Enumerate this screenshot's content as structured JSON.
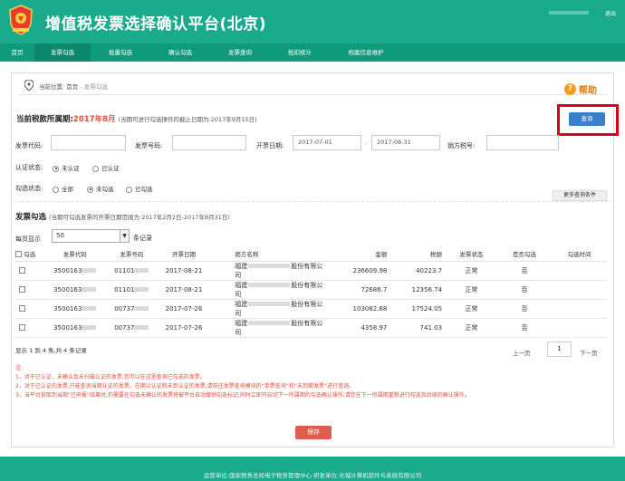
{
  "header": {
    "title": "增值税发票选择确认平台(北京)",
    "logout": "退出",
    "brand_color": "#1aab8c"
  },
  "nav": {
    "items": [
      {
        "label": "首页",
        "width": 38
      },
      {
        "label": "发票勾选",
        "width": 62,
        "active": true
      },
      {
        "label": "批量勾选",
        "width": 66
      },
      {
        "label": "确认勾选",
        "width": 66
      },
      {
        "label": "发票查询",
        "width": 66
      },
      {
        "label": "抵扣统计",
        "width": 66
      },
      {
        "label": "档案信息维护",
        "width": 80
      }
    ]
  },
  "breadcrumb": {
    "label": "当前位置:",
    "home": "首页",
    "sep": " - ",
    "current": "发票勾选"
  },
  "help": {
    "label": "帮助"
  },
  "period": {
    "label": "当前税款所属期:",
    "value": "2017年8月",
    "note": "(当期可进行勾选操作的截止日期为:2017年9月15日)"
  },
  "query_button": "查询",
  "filters": {
    "invoice_code_label": "发票代码:",
    "invoice_number_label": "发票号码:",
    "date_label": "开票日期:",
    "date_from": "2017-07-01",
    "date_sep": "-",
    "date_to": "2017-08-31",
    "seller_tax_label": "销方税号:",
    "auth_label": "认证状态:",
    "auth_options": [
      "未认证",
      "已认证"
    ],
    "check_label": "勾选状态:",
    "check_options": [
      "全部",
      "未勾选",
      "已勾选"
    ],
    "more_button": "更多查询条件"
  },
  "invoice_section": {
    "title": "发票勾选",
    "note": "(当期可勾选发票的开票日期范围为:2017年2月2日-2017年8月31日)",
    "page_size_label": "每页显示",
    "page_size": "50",
    "records_label": "条记录"
  },
  "table": {
    "columns": [
      "勾选",
      "发票代码",
      "发票号码",
      "开票日期",
      "销方名称",
      "金额",
      "税额",
      "发票状态",
      "是否勾选",
      "勾选时间"
    ],
    "rows": [
      {
        "code": "3500163",
        "number": "01101",
        "date": "2017-08-21",
        "seller_prefix": "福建",
        "seller_suffix": "股份有限公司",
        "amount": "236609.98",
        "tax": "40223.7",
        "status": "正常",
        "checked": "否",
        "time": ""
      },
      {
        "code": "3500163",
        "number": "01101",
        "date": "2017-08-21",
        "seller_prefix": "福建",
        "seller_suffix": "股份有限公司",
        "amount": "72686.7",
        "tax": "12356.74",
        "status": "正常",
        "checked": "否",
        "time": ""
      },
      {
        "code": "3500163",
        "number": "00737",
        "date": "2017-07-26",
        "seller_prefix": "福建",
        "seller_suffix": "股份有限公司",
        "amount": "103082.68",
        "tax": "17524.05",
        "status": "正常",
        "checked": "否",
        "time": ""
      },
      {
        "code": "3500163",
        "number": "00737",
        "date": "2017-07-26",
        "seller_prefix": "福建",
        "seller_suffix": "股份有限公司",
        "amount": "4358.97",
        "tax": "741.03",
        "status": "正常",
        "checked": "否",
        "time": ""
      }
    ]
  },
  "pager": {
    "summary": "显示 1 到 4 条,共 4 条记录",
    "prev": "上一页",
    "current": "1",
    "next": "下一页"
  },
  "notes": [
    "注:",
    "1、对于已认证、未确认及未扫描认证的发票,您可以在这里查询已勾选的发票。",
    "2、对于已认证的发票,只能查询当期认证的发票。在期以认证和未到认证的发票,请前往发票查询模块的“单票查询”和“未到期发票”进行查询。",
    "3、当平台获取到当期“已申报”结果时,仍需要在勾选未确认的发票将被平台自动撤销勾选标记,同时立即开启切下一所属期的勾选确认操作,请您在下一所属期重新进行勾选及后续的确认操作。"
  ],
  "save_button": "保存",
  "footer": {
    "text": "运营单位:国家税务总局电子税务管理中心 研发单位:长城计算机软件与系统有限公司"
  }
}
